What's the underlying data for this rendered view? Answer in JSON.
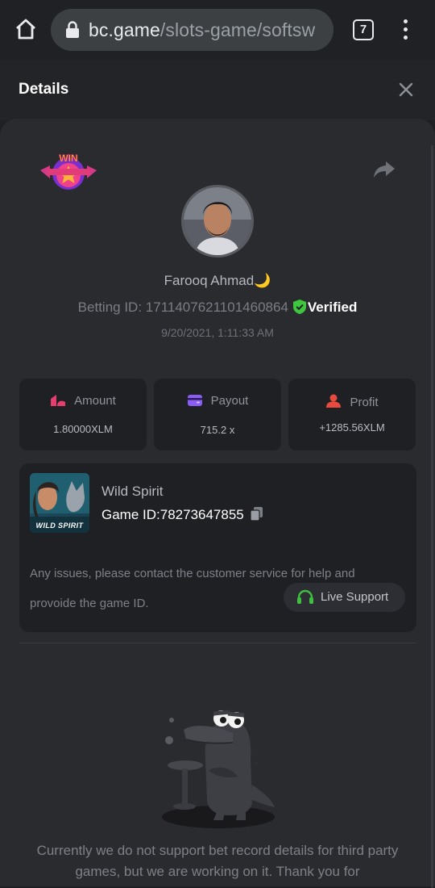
{
  "browser": {
    "url_domain": "bc.game",
    "url_path": "/slots-game/softsw",
    "tab_count": "7"
  },
  "panel": {
    "title": "Details"
  },
  "user": {
    "name": "Farooq Ahmad🌙",
    "betting_id_label": "Betting ID:",
    "betting_id": "1711407621101460864",
    "verified_label": "Verified",
    "bet_time": "9/20/2021, 1:11:33 AM"
  },
  "stats": [
    {
      "label": "Amount",
      "value": "1.80000XLM",
      "icon": "coins-icon",
      "color": "#e83e6f"
    },
    {
      "label": "Payout",
      "value": "715.2 x",
      "icon": "wallet-icon",
      "color": "#8b5cf6"
    },
    {
      "label": "Profit",
      "value": "+1285.56XLM",
      "icon": "profit-icon",
      "color": "#e84a3e"
    }
  ],
  "game": {
    "thumb_label": "WILD SPIRIT",
    "name": "Wild Spirit",
    "id_label": "Game ID:",
    "id": "78273647855",
    "notice": "Any issues, please contact the customer service for help and provoide the game ID.",
    "support_label": "Live Support",
    "accent": "#3fbf3f"
  },
  "footer": {
    "unsupported_text": "Currently we do not support bet record details for third party games, but we are working on it. Thank you for"
  }
}
